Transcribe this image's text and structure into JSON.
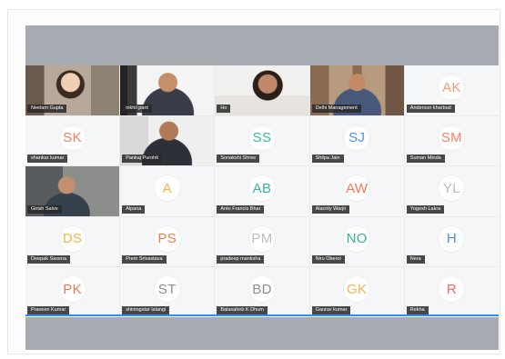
{
  "colors": {
    "top_band": "#a7abb2",
    "bottom_band": "#a7abb2",
    "tile_bg": "#f5f6f8",
    "name_bg": "#282828"
  },
  "participants": [
    {
      "name": "Neelam Gupta",
      "video": true,
      "video_class": "v-neelam"
    },
    {
      "name": "nikhil pant",
      "video": true,
      "video_class": "v-nikhil"
    },
    {
      "name": "Ho",
      "video": true,
      "video_class": "v-ho"
    },
    {
      "name": "Delhi Management",
      "video": true,
      "video_class": "v-delhi"
    },
    {
      "name": "Anderson kharbud",
      "initials": "AK",
      "color": "#f39a7a"
    },
    {
      "name": "shankar kumar",
      "initials": "SK",
      "color": "#ef8060"
    },
    {
      "name": "Pankaj Purohit",
      "video": true,
      "video_class": "v-pankaj"
    },
    {
      "name": "Sonakshi Shree",
      "initials": "SS",
      "color": "#37b9a2"
    },
    {
      "name": "Shilpa Jain",
      "initials": "SJ",
      "color": "#4f8fde"
    },
    {
      "name": "Suman Minda",
      "initials": "SM",
      "color": "#f08466"
    },
    {
      "name": "Girish Salve",
      "video": true,
      "video_class": "v-girish"
    },
    {
      "name": "Alpana",
      "initials": "A",
      "color": "#f2b64a"
    },
    {
      "name": "Anto Francis Bhar",
      "initials": "AB",
      "color": "#3bb39e"
    },
    {
      "name": "Alacrity Warjri",
      "initials": "AW",
      "color": "#f07b4f"
    },
    {
      "name": "Yogesh Lakra",
      "initials": "YL",
      "color": "#b8b8c2"
    },
    {
      "name": "Deepak Saxena",
      "initials": "DS",
      "color": "#f2b64a"
    },
    {
      "name": "Prem Srivastava",
      "initials": "PS",
      "color": "#ef7b4d"
    },
    {
      "name": "pradeep manksha",
      "initials": "PM",
      "color": "#bdbdc6"
    },
    {
      "name": "Niru Oberoi",
      "initials": "NO",
      "color": "#34b29c"
    },
    {
      "name": "Nera",
      "initials": "H",
      "color": "#4f8fde"
    },
    {
      "name": "Praveen Kumar",
      "initials": "PK",
      "color": "#ef7b4d"
    },
    {
      "name": "shiningstar lalangi",
      "initials": "ST",
      "color": "#8b8b95"
    },
    {
      "name": "Balasaheb K Dhum",
      "initials": "BD",
      "color": "#8e8e98"
    },
    {
      "name": "Gaurav kumar",
      "initials": "GK",
      "color": "#f2b64a"
    },
    {
      "name": "Rekha",
      "initials": "R",
      "color": "#ef6c57"
    }
  ]
}
